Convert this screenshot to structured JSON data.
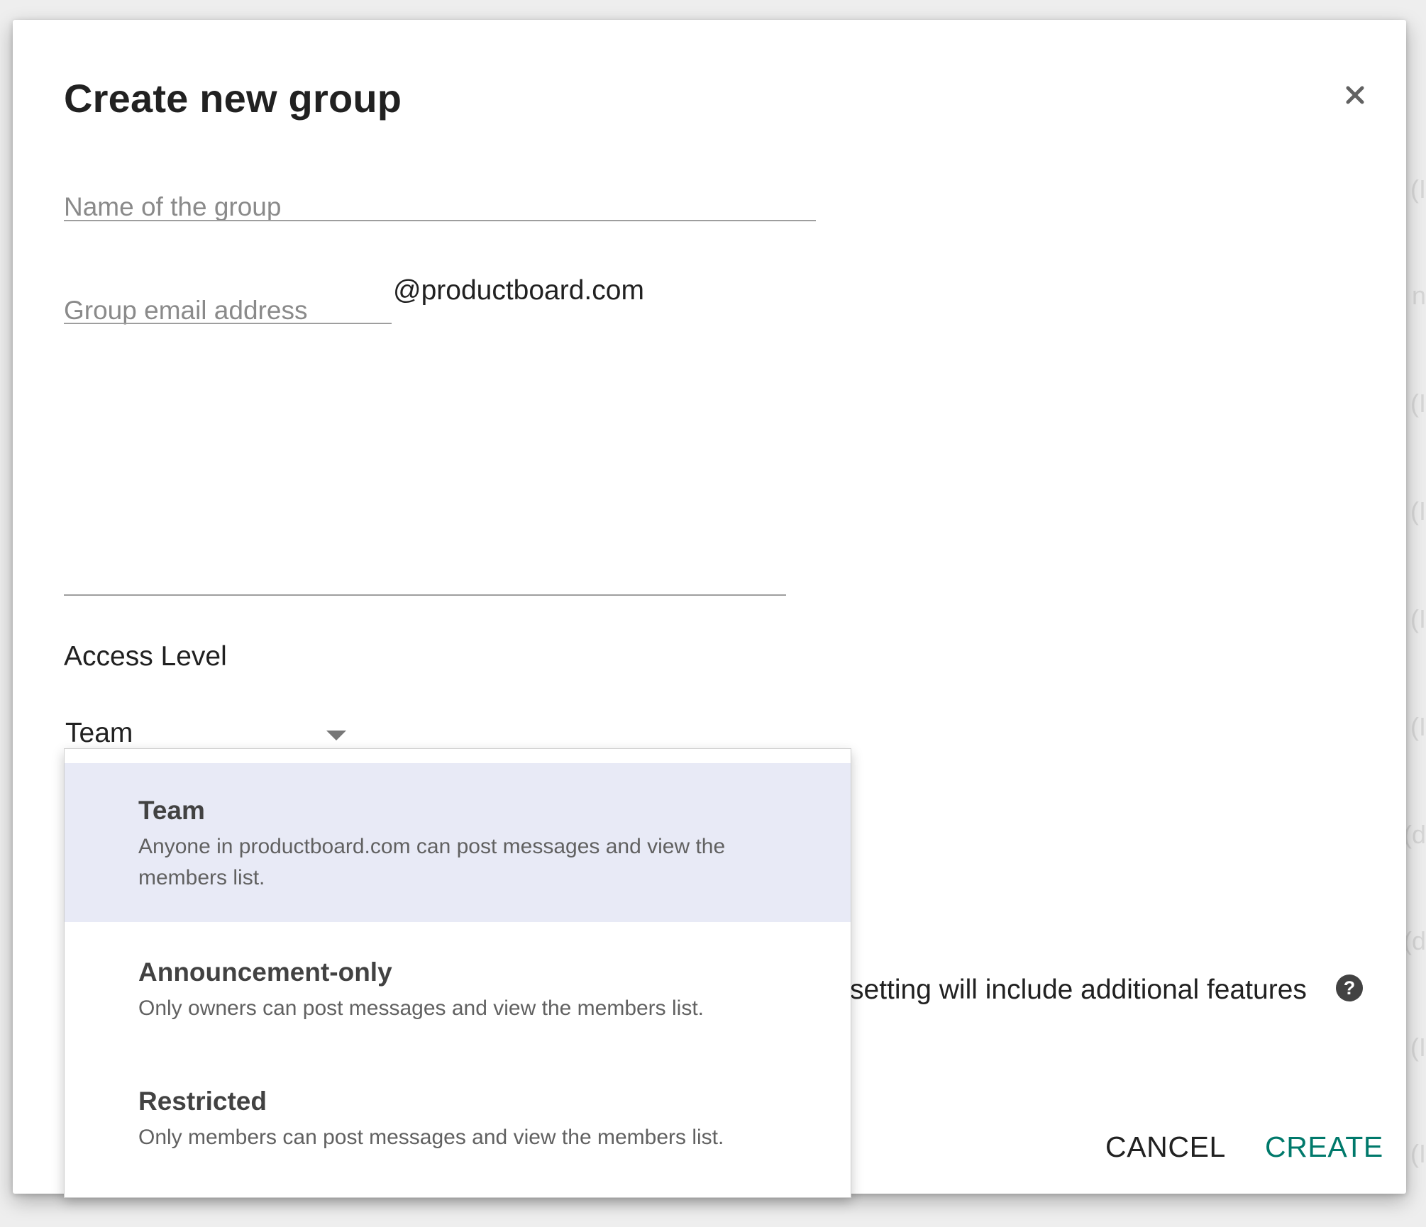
{
  "dialog": {
    "title": "Create new group",
    "name_field": {
      "placeholder": "Name of the group",
      "value": ""
    },
    "email_field": {
      "placeholder": "Group email address",
      "value": ""
    },
    "domain_suffix": "@productboard.com",
    "access_level_label": "Access Level",
    "access_level_selected": "Team",
    "covered_note": "setting will include additional features",
    "buttons": {
      "cancel": "CANCEL",
      "create": "CREATE"
    }
  },
  "dropdown": {
    "options": [
      {
        "title": "Team",
        "description": "Anyone in productboard.com can post messages and view the members list.",
        "selected": true
      },
      {
        "title": "Announcement-only",
        "description": "Only owners can post messages and view the members list.",
        "selected": false
      },
      {
        "title": "Restricted",
        "description": "Only members can post messages and view the members list.",
        "selected": false
      }
    ]
  },
  "colors": {
    "accent": "#00796b",
    "selected_option_bg": "#e8eaf6",
    "text_primary": "#212121",
    "text_secondary": "#616161",
    "placeholder": "#8a8a8a"
  },
  "icons": {
    "close": "close-icon",
    "help": "help-circle-icon",
    "caret": "dropdown-caret-icon"
  }
}
